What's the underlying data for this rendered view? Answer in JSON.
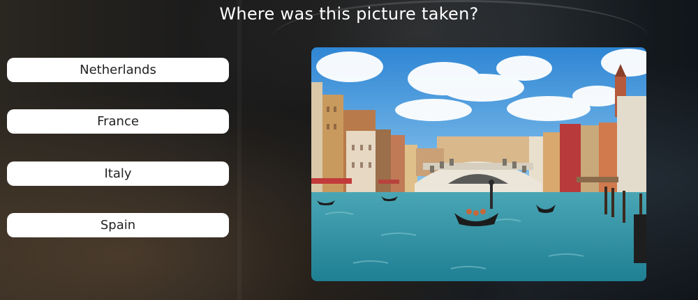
{
  "question": "Where was this picture taken?",
  "answers": [
    {
      "label": "Netherlands"
    },
    {
      "label": "France"
    },
    {
      "label": "Italy"
    },
    {
      "label": "Spain"
    }
  ],
  "photo": {
    "icon": "venice-grand-canal-photo",
    "colors": {
      "sky": "#3a8fd6",
      "water": "#2e8aa0",
      "bridge": "#e8e2d6"
    }
  }
}
